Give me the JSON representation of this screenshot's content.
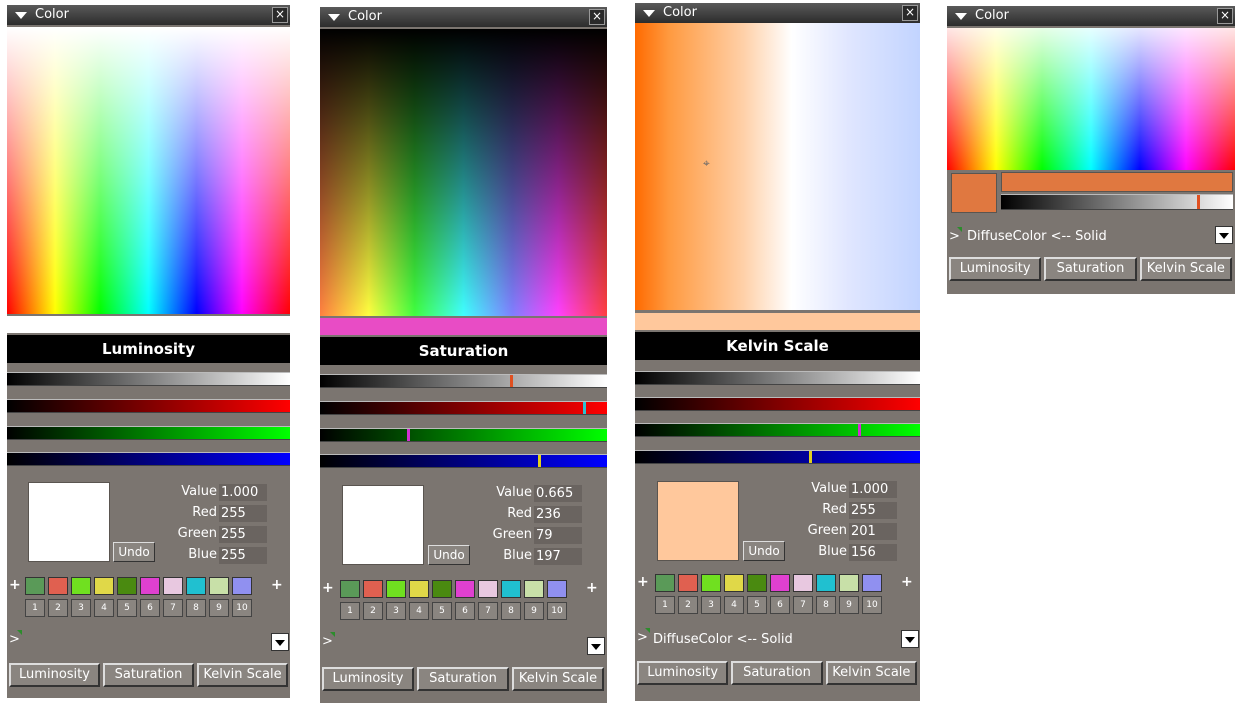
{
  "title": "Color",
  "close_glyph": "×",
  "tabs": [
    "Luminosity",
    "Saturation",
    "Kelvin Scale"
  ],
  "undo_label": "Undo",
  "labels": {
    "value": "Value",
    "red": "Red",
    "green": "Green",
    "blue": "Blue"
  },
  "palette_colors": [
    "#5a9a58",
    "#e06050",
    "#70e020",
    "#e0d848",
    "#4a8a10",
    "#e040d0",
    "#e8c8e0",
    "#20c0d0",
    "#c8e0a8",
    "#9090f0"
  ],
  "palette_numbers": [
    "1",
    "2",
    "3",
    "4",
    "5",
    "6",
    "7",
    "8",
    "9",
    "10"
  ],
  "panels": [
    {
      "mode": "Luminosity",
      "value": "1.000",
      "red": "255",
      "green": "255",
      "blue": "255",
      "color": "#ffffff"
    },
    {
      "mode": "Saturation",
      "value": "0.665",
      "red": "236",
      "green": "79",
      "blue": "197",
      "color": "#ffffff"
    },
    {
      "mode": "Kelvin Scale",
      "value": "1.000",
      "red": "255",
      "green": "201",
      "blue": "156",
      "color": "#ffc89c",
      "diffuse": "DiffuseColor <-- Solid"
    },
    {
      "diffuse": "DiffuseColor <-- Solid",
      "color": "#e07840"
    }
  ],
  "expander_glyph": ">",
  "plus_glyph": "+"
}
